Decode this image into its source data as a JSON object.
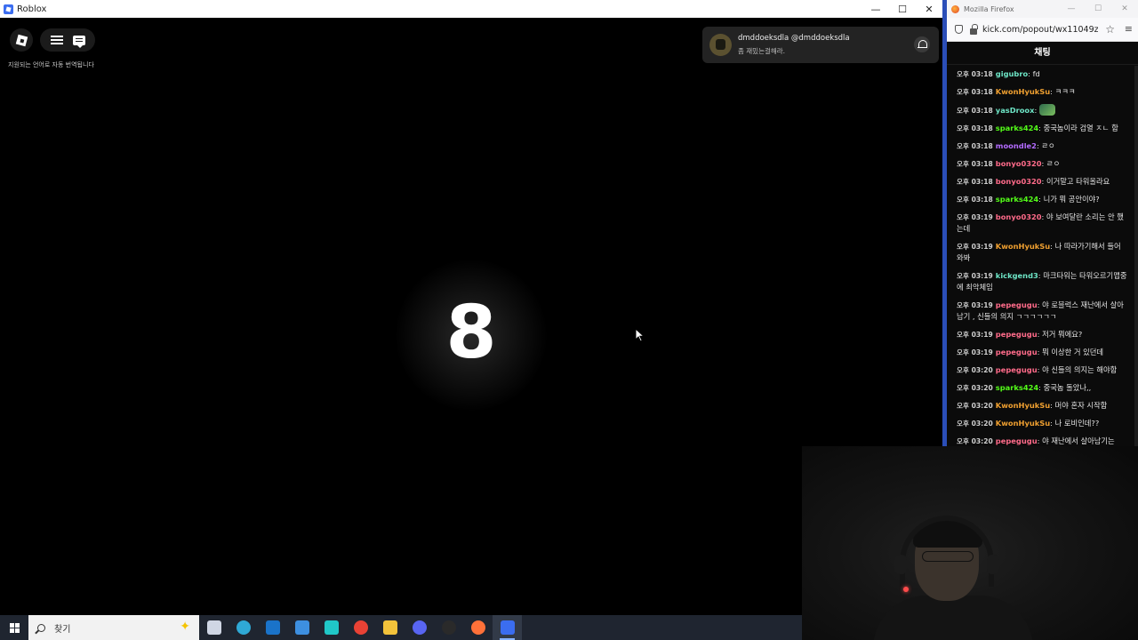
{
  "roblox_window": {
    "title": "Roblox",
    "controls": {
      "minimize": "—",
      "maximize": "☐",
      "close": "✕"
    },
    "translate_note": "지원되는 언어로 자동 번역됩니다",
    "countdown": "8",
    "notification": {
      "name": "dmddoeksdla @dmddoeksdla",
      "message": "좀 재밌는걸해라."
    }
  },
  "firefox_window": {
    "title": "Mozilla Firefox",
    "controls": {
      "minimize": "—",
      "maximize": "☐",
      "close": "✕"
    },
    "url": "kick.com/popout/wx11049zj83",
    "chat_title": "채팅"
  },
  "chat": {
    "messages": [
      {
        "time": "오후 03:18",
        "user": "gigubro",
        "color": "#6ee6c7",
        "text": "fd"
      },
      {
        "time": "오후 03:18",
        "user": "KwonHyukSu",
        "color": "#f0a030",
        "text": "ㅋㅋㅋ"
      },
      {
        "time": "오후 03:18",
        "user": "yasDroox",
        "color": "#6ee6c7",
        "text": ""
      },
      {
        "time": "오후 03:18",
        "user": "sparks424",
        "color": "#53fc18",
        "text": "중국놈이라 검열 ㅈㄴ 함"
      },
      {
        "time": "오후 03:18",
        "user": "moondle2",
        "color": "#b36bff",
        "text": "ㄹㅇ"
      },
      {
        "time": "오후 03:18",
        "user": "bonyo0320",
        "color": "#ff6b8a",
        "text": "ㄹㅇ"
      },
      {
        "time": "오후 03:18",
        "user": "bonyo0320",
        "color": "#ff6b8a",
        "text": "이거말고 타워올라요"
      },
      {
        "time": "오후 03:18",
        "user": "sparks424",
        "color": "#53fc18",
        "text": "니가 뭐 공안이야?"
      },
      {
        "time": "오후 03:19",
        "user": "bonyo0320",
        "color": "#ff6b8a",
        "text": "야 보여달란 소리는 안 했는데"
      },
      {
        "time": "오후 03:19",
        "user": "KwonHyukSu",
        "color": "#f0a030",
        "text": "나 따라가기해서 들어와봐"
      },
      {
        "time": "오후 03:19",
        "user": "kickgend3",
        "color": "#6ee6c7",
        "text": "마크타워는 타워오르기맵중에 최악체임"
      },
      {
        "time": "오후 03:19",
        "user": "pepegugu",
        "color": "#ff6b8a",
        "text": "야 로블럭스 재난에서 살아남기 , 신들의 의지 ㄱㄱㄱㄱㄱㄱ"
      },
      {
        "time": "오후 03:19",
        "user": "pepegugu",
        "color": "#ff6b8a",
        "text": "저거 뭐에요?"
      },
      {
        "time": "오후 03:19",
        "user": "pepegugu",
        "color": "#ff6b8a",
        "text": "뭐 이상한 거 있던데"
      },
      {
        "time": "오후 03:20",
        "user": "pepegugu",
        "color": "#ff6b8a",
        "text": "야 신들의 의지는 해야함"
      },
      {
        "time": "오후 03:20",
        "user": "sparks424",
        "color": "#53fc18",
        "text": "중국놈 돌았나,,"
      },
      {
        "time": "오후 03:20",
        "user": "KwonHyukSu",
        "color": "#f0a030",
        "text": "머야 혼자 시작함"
      },
      {
        "time": "오후 03:20",
        "user": "KwonHyukSu",
        "color": "#f0a030",
        "text": "나 로비인데??"
      },
      {
        "time": "오후 03:20",
        "user": "pepegugu",
        "color": "#ff6b8a",
        "text": "야 재난에서 살아남기는"
      }
    ]
  },
  "taskbar": {
    "search_placeholder": "찾기",
    "apps": [
      {
        "name": "task-view",
        "color": "#cfd6e4"
      },
      {
        "name": "edge",
        "color": "#2fa9d6"
      },
      {
        "name": "outlook",
        "color": "#1a73c9"
      },
      {
        "name": "store",
        "color": "#3d8fe0"
      },
      {
        "name": "bird-app",
        "color": "#20c8c8"
      },
      {
        "name": "chrome",
        "color": "#e94235"
      },
      {
        "name": "file-explorer",
        "color": "#f3c33b"
      },
      {
        "name": "discord",
        "color": "#5865f2"
      },
      {
        "name": "obs",
        "color": "#2a2a2a"
      },
      {
        "name": "firefox",
        "color": "#ff7139"
      },
      {
        "name": "roblox",
        "color": "#3b6df0"
      }
    ]
  }
}
